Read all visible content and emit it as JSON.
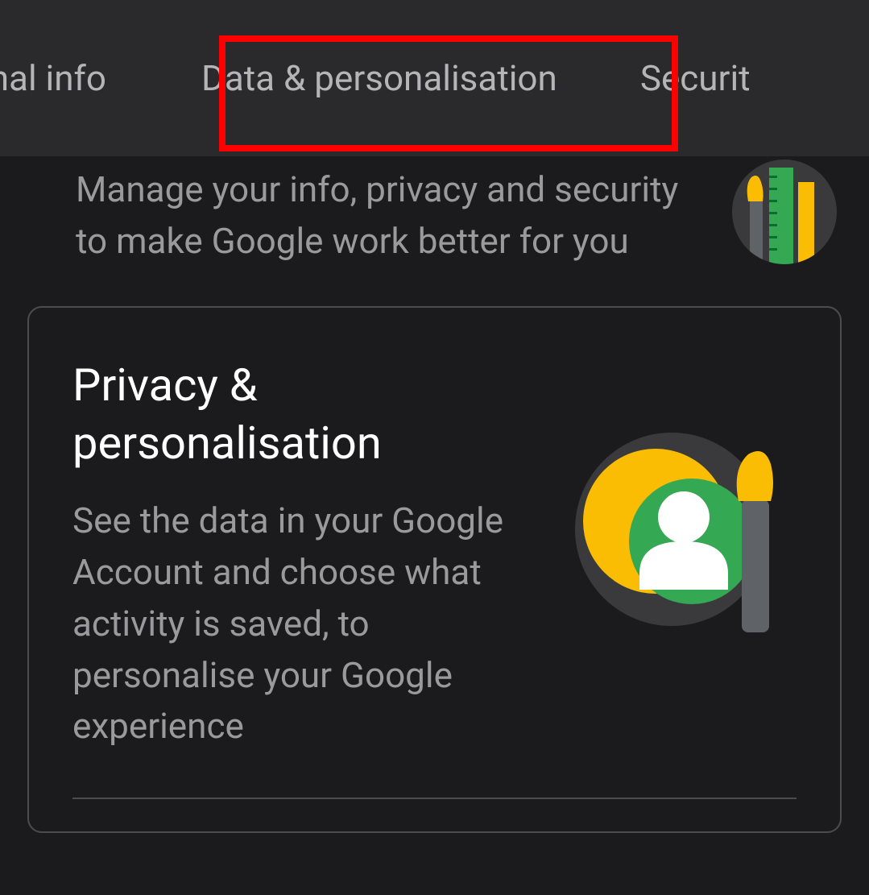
{
  "tabs": {
    "personal_info": "rsonal info",
    "data_personalisation": "Data & personalisation",
    "security": "Securit"
  },
  "intro": {
    "text": "Manage your info, privacy and security to make Google work better for you"
  },
  "card": {
    "title": "Privacy & personalisation",
    "description": "See the data in your Google Account and choose what activity is saved, to personalise your Google experience"
  }
}
